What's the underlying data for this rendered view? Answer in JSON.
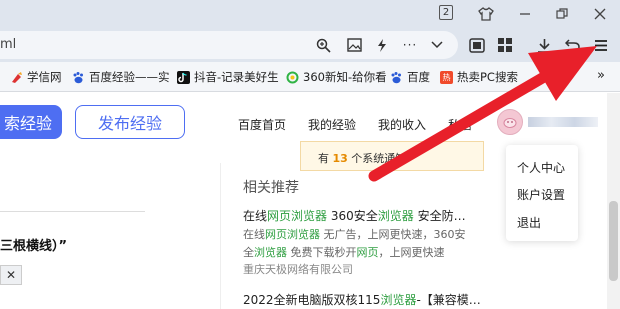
{
  "window": {
    "tab_count": "2"
  },
  "address": {
    "url_fragment": "ml"
  },
  "bookmarks": [
    {
      "label": "学信网",
      "icon": "xuexin-icon"
    },
    {
      "label": "百度经验——实",
      "icon": "baidu-paw-icon"
    },
    {
      "label": "抖音-记录美好生",
      "icon": "tiktok-icon"
    },
    {
      "label": "360新知-给你看",
      "icon": "360-icon"
    },
    {
      "label": "百度",
      "icon": "baidu-paw-icon"
    },
    {
      "label": "热卖PC搜索",
      "icon": "hot-sale-icon"
    }
  ],
  "header": {
    "search_btn": "索经验",
    "publish_btn": "发布经验",
    "nav": [
      "百度首页",
      "我的经验",
      "我的收入",
      "私信"
    ]
  },
  "notice": {
    "prefix": "有 ",
    "count": "13",
    "suffix": " 个系统通知"
  },
  "user_menu": [
    "个人中心",
    "账户设置",
    "退出"
  ],
  "left": {
    "text": "三根横线）”",
    "close": "✕"
  },
  "related": {
    "title": "相关推荐",
    "item1": {
      "title_a": "在线",
      "title_hl": "网页浏览器",
      "title_b": " 360安全",
      "title_hl2": "浏览器",
      "title_c": " 安全防…",
      "desc1_a": "在线",
      "desc1_hl": "网页浏览器",
      "desc1_b": " 无广告，上网更快速，360安",
      "desc2_a": "全",
      "desc2_hl": "浏览器",
      "desc2_b": " 免费下载秒开",
      "desc2_hl2": "网页",
      "desc2_c": "，上网更快速",
      "source": "重庆天极网络有限公司"
    },
    "item2": {
      "title_a": "2022全新电脑版双核115",
      "title_hl": "浏览器",
      "title_b": "-【兼容模…"
    }
  },
  "colors": {
    "brand_blue": "#4e6ef2",
    "highlight_green": "#2e9e40",
    "arrow_red": "#e8202a",
    "notice_orange": "#e58a00"
  }
}
